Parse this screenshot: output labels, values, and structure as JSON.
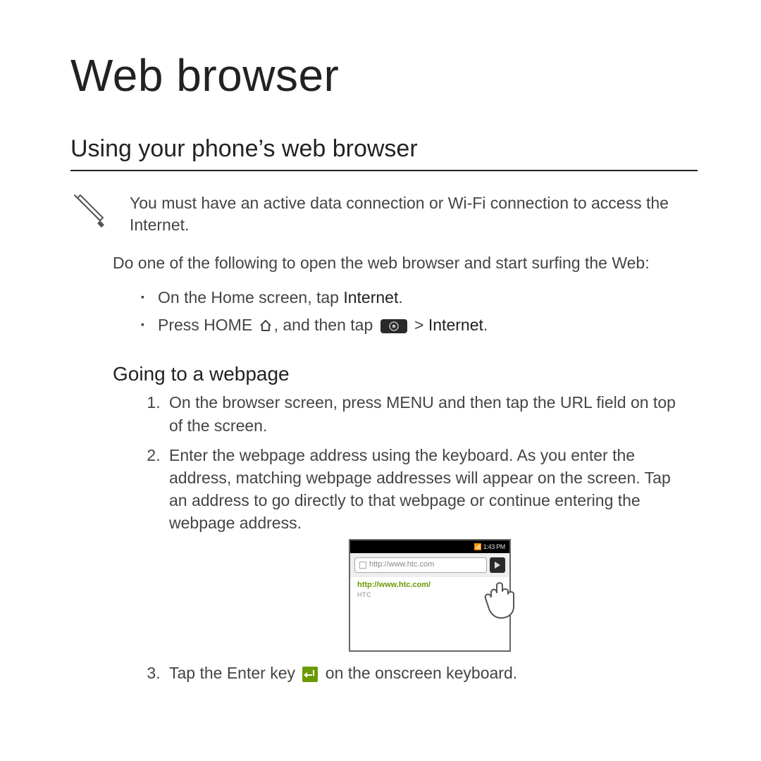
{
  "title": "Web browser",
  "section": "Using your phone’s web browser",
  "note": "You must have an active data connection or Wi-Fi connection to access the Internet.",
  "intro": "Do one of the following to open the web browser and start surfing the Web:",
  "bullets": {
    "b1_pre": "On the Home screen, tap ",
    "b1_bold": "Internet",
    "b1_post": ".",
    "b2_pre": "Press HOME ",
    "b2_mid": ", and then tap ",
    "b2_chev": " > ",
    "b2_bold": "Internet",
    "b2_post": "."
  },
  "sub": "Going to a webpage",
  "steps": {
    "s1": "On the browser screen, press MENU and then tap the URL field on top of the screen.",
    "s2": "Enter the webpage address using the keyboard. As you enter the address, matching webpage addresses will appear on the screen. Tap an address to go directly to that webpage or continue entering the webpage address.",
    "s3_pre": "Tap the Enter key ",
    "s3_post": " on the onscreen keyboard."
  },
  "screenshot": {
    "status_time": "1:43 PM",
    "url_placeholder": "http://www.htc.com",
    "suggestion_match": "http://www.htc.com/",
    "suggestion_sub": "HTC"
  }
}
